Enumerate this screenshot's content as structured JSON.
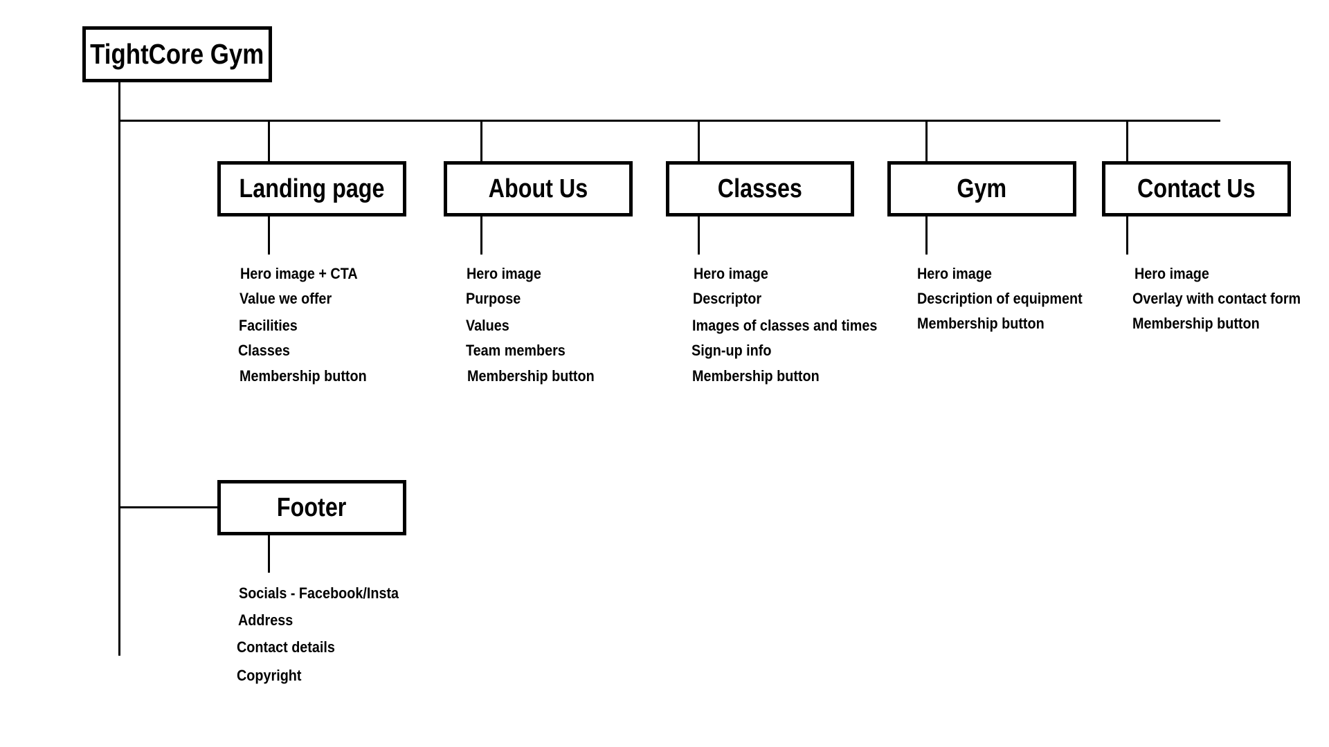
{
  "root": {
    "label": "TightCore Gym"
  },
  "pages": [
    {
      "label": "Landing page",
      "items": [
        "Hero image + CTA",
        "Value we offer",
        "Facilities",
        "Classes",
        "Membership button"
      ]
    },
    {
      "label": "About Us",
      "items": [
        "Hero image",
        "Purpose",
        "Values",
        "Team members",
        "Membership button"
      ]
    },
    {
      "label": "Classes",
      "items": [
        "Hero image",
        "Descriptor",
        "Images of classes and times",
        "Sign-up info",
        "Membership button"
      ]
    },
    {
      "label": "Gym",
      "items": [
        "Hero image",
        "Description of equipment",
        "Membership button"
      ]
    },
    {
      "label": "Contact Us",
      "items": [
        "Hero image",
        "Overlay with contact form",
        "Membership button"
      ]
    }
  ],
  "footer": {
    "label": "Footer",
    "items": [
      "Socials - Facebook/Insta",
      "Address",
      "Contact details",
      "Copyright"
    ]
  }
}
